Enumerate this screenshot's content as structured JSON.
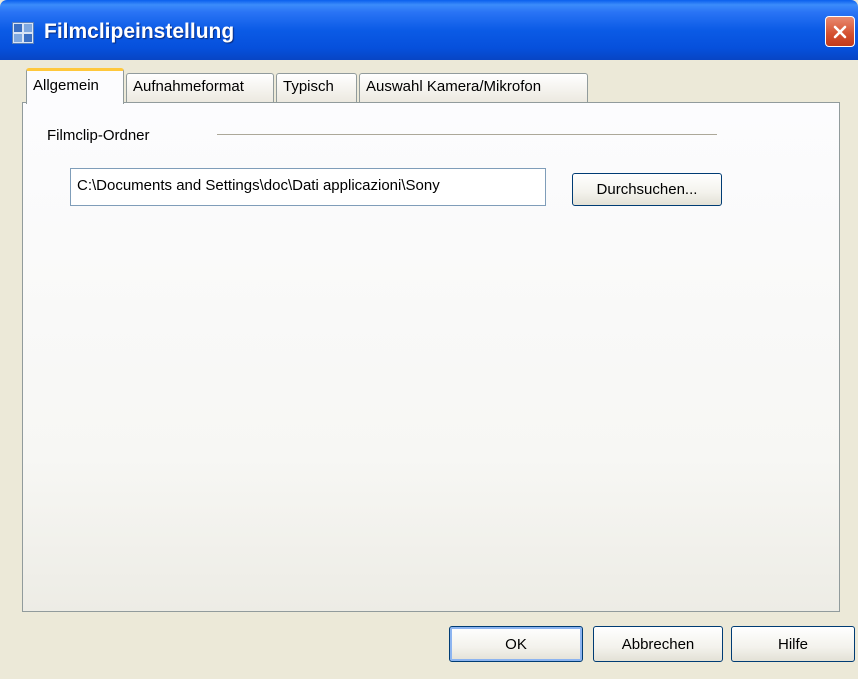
{
  "window": {
    "title": "Filmclipeinstellung"
  },
  "tabs": [
    {
      "label": "Allgemein",
      "active": true
    },
    {
      "label": "Aufnahmeformat",
      "active": false
    },
    {
      "label": "Typisch",
      "active": false
    },
    {
      "label": "Auswahl Kamera/Mikrofon",
      "active": false
    }
  ],
  "general": {
    "group_label": "Filmclip-Ordner",
    "folder_path": "C:\\Documents and Settings\\doc\\Dati applicazioni\\Sony",
    "browse_label": "Durchsuchen..."
  },
  "footer": {
    "ok_label": "OK",
    "cancel_label": "Abbrechen",
    "help_label": "Hilfe"
  },
  "colors": {
    "titlebar": "#0B5BE6",
    "active_tab_highlight": "#FFC83C",
    "close_button": "#D4502F"
  },
  "icons": {
    "app": "app-icon",
    "close": "close-icon"
  }
}
